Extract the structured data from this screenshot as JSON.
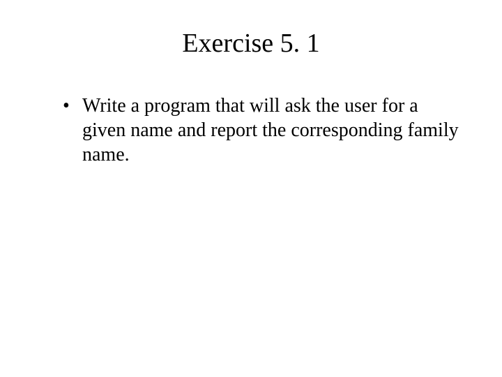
{
  "slide": {
    "title": "Exercise 5. 1",
    "bullets": [
      "Write a program that will ask the user for a given name and report the corresponding family name."
    ]
  }
}
